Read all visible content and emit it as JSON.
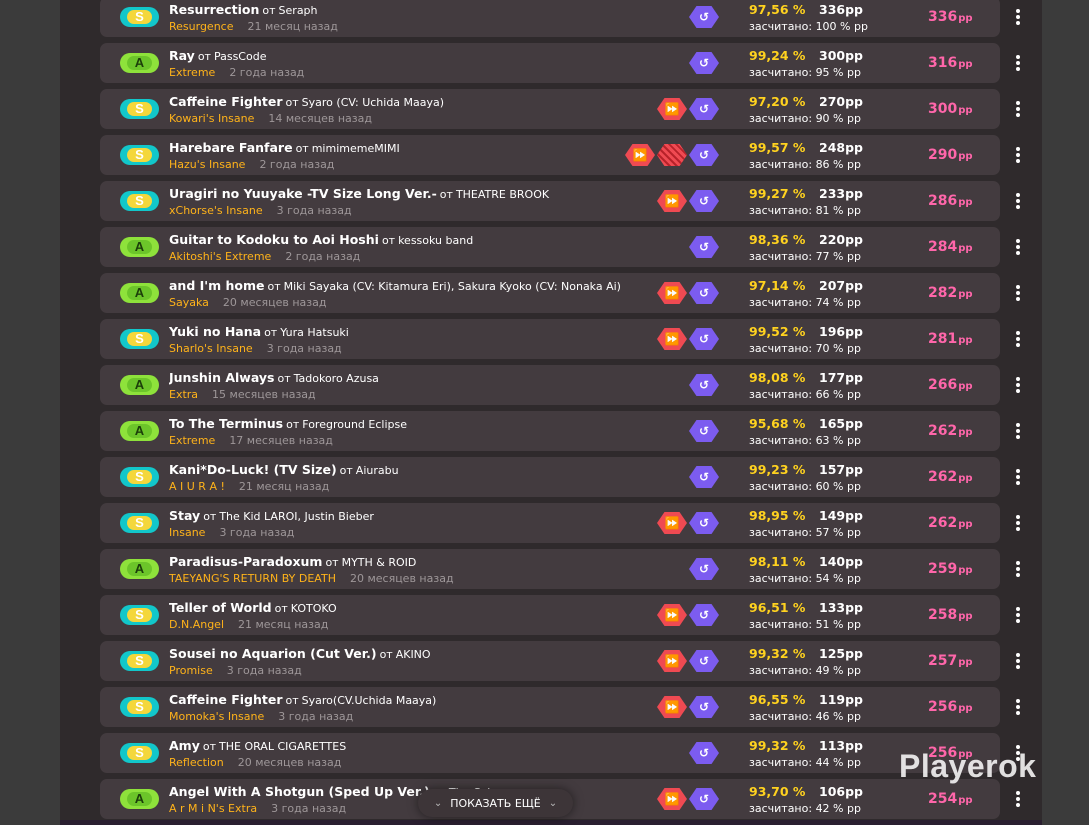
{
  "show_more": {
    "label": "ПОКАЗАТЬ ЕЩЁ"
  },
  "watermark": "Playerok",
  "by_word": "от",
  "counted_prefix": "засчитано:",
  "pp_unit": "pp",
  "colors": {
    "grade_S": "#12c7ca",
    "grade_A": "#8ee23b",
    "accuracy": "#ffd21f",
    "difficulty": "#ffb31a",
    "weighted_pp": "#ff66aa",
    "mod_purple": "#7c5cf0",
    "mod_red": "#ef4a52"
  },
  "scores": [
    {
      "grade": "S",
      "title": "Resurrection",
      "artist": "Seraph",
      "difficulty": "Resurgence",
      "ago": "21 месяц назад",
      "mods": [
        "pp"
      ],
      "accuracy": "97,56 %",
      "pp": "336pp",
      "weight": "100 % pp",
      "weighted": "336"
    },
    {
      "grade": "A",
      "title": "Ray",
      "artist": "PassCode",
      "difficulty": "Extreme",
      "ago": "2 года назад",
      "mods": [
        "pp"
      ],
      "accuracy": "99,24 %",
      "pp": "300pp",
      "weight": "95 % pp",
      "weighted": "316"
    },
    {
      "grade": "S",
      "title": "Caffeine Fighter",
      "artist": "Syaro (CV: Uchida Maaya)",
      "difficulty": "Kowari's Insane",
      "ago": "14 месяцев назад",
      "mods": [
        "ht",
        "pp"
      ],
      "accuracy": "97,20 %",
      "pp": "270pp",
      "weight": "90 % pp",
      "weighted": "300"
    },
    {
      "grade": "S",
      "title": "Harebare Fanfare",
      "artist": "mimimemeMIMI",
      "difficulty": "Hazu's Insane",
      "ago": "2 года назад",
      "mods": [
        "ht",
        "dt",
        "pp"
      ],
      "accuracy": "99,57 %",
      "pp": "248pp",
      "weight": "86 % pp",
      "weighted": "290"
    },
    {
      "grade": "S",
      "title": "Uragiri no Yuuyake -TV Size Long Ver.-",
      "artist": "THEATRE BROOK",
      "difficulty": "xChorse's Insane",
      "ago": "3 года назад",
      "mods": [
        "ht",
        "pp"
      ],
      "accuracy": "99,27 %",
      "pp": "233pp",
      "weight": "81 % pp",
      "weighted": "286"
    },
    {
      "grade": "A",
      "title": "Guitar to Kodoku to Aoi Hoshi",
      "artist": "kessoku band",
      "difficulty": "Akitoshi's Extreme",
      "ago": "2 года назад",
      "mods": [
        "pp"
      ],
      "accuracy": "98,36 %",
      "pp": "220pp",
      "weight": "77 % pp",
      "weighted": "284"
    },
    {
      "grade": "A",
      "title": "and I'm home",
      "artist": "Miki Sayaka (CV: Kitamura Eri), Sakura Kyoko (CV: Nonaka Ai)",
      "difficulty": "Sayaka",
      "ago": "20 месяцев назад",
      "mods": [
        "ht",
        "pp"
      ],
      "accuracy": "97,14 %",
      "pp": "207pp",
      "weight": "74 % pp",
      "weighted": "282"
    },
    {
      "grade": "S",
      "title": "Yuki no Hana",
      "artist": "Yura Hatsuki",
      "difficulty": "Sharlo's Insane",
      "ago": "3 года назад",
      "mods": [
        "ht",
        "pp"
      ],
      "accuracy": "99,52 %",
      "pp": "196pp",
      "weight": "70 % pp",
      "weighted": "281"
    },
    {
      "grade": "A",
      "title": "Junshin Always",
      "artist": "Tadokoro Azusa",
      "difficulty": "Extra",
      "ago": "15 месяцев назад",
      "mods": [
        "pp"
      ],
      "accuracy": "98,08 %",
      "pp": "177pp",
      "weight": "66 % pp",
      "weighted": "266"
    },
    {
      "grade": "A",
      "title": "To The Terminus",
      "artist": "Foreground Eclipse",
      "difficulty": "Extreme",
      "ago": "17 месяцев назад",
      "mods": [
        "pp"
      ],
      "accuracy": "95,68 %",
      "pp": "165pp",
      "weight": "63 % pp",
      "weighted": "262"
    },
    {
      "grade": "S",
      "title": "Kani*Do-Luck! (TV Size)",
      "artist": "Aiurabu",
      "difficulty": "A I U R A !",
      "ago": "21 месяц назад",
      "mods": [
        "pp"
      ],
      "accuracy": "99,23 %",
      "pp": "157pp",
      "weight": "60 % pp",
      "weighted": "262"
    },
    {
      "grade": "S",
      "title": "Stay",
      "artist": "The Kid LAROI, Justin Bieber",
      "difficulty": "Insane",
      "ago": "3 года назад",
      "mods": [
        "ht",
        "pp"
      ],
      "accuracy": "98,95 %",
      "pp": "149pp",
      "weight": "57 % pp",
      "weighted": "262"
    },
    {
      "grade": "A",
      "title": "Paradisus-Paradoxum",
      "artist": "MYTH & ROID",
      "difficulty": "TAEYANG'S RETURN BY DEATH",
      "ago": "20 месяцев назад",
      "mods": [
        "pp"
      ],
      "accuracy": "98,11 %",
      "pp": "140pp",
      "weight": "54 % pp",
      "weighted": "259"
    },
    {
      "grade": "S",
      "title": "Teller of World",
      "artist": "KOTOKO",
      "difficulty": "D.N.Angel",
      "ago": "21 месяц назад",
      "mods": [
        "ht",
        "pp"
      ],
      "accuracy": "96,51 %",
      "pp": "133pp",
      "weight": "51 % pp",
      "weighted": "258"
    },
    {
      "grade": "S",
      "title": "Sousei no Aquarion (Cut Ver.)",
      "artist": "AKINO",
      "difficulty": "Promise",
      "ago": "3 года назад",
      "mods": [
        "ht",
        "pp"
      ],
      "accuracy": "99,32 %",
      "pp": "125pp",
      "weight": "49 % pp",
      "weighted": "257"
    },
    {
      "grade": "S",
      "title": "Caffeine Fighter",
      "artist": "Syaro(CV.Uchida Maaya)",
      "difficulty": "Momoka's Insane",
      "ago": "3 года назад",
      "mods": [
        "ht",
        "pp"
      ],
      "accuracy": "96,55 %",
      "pp": "119pp",
      "weight": "46 % pp",
      "weighted": "256"
    },
    {
      "grade": "S",
      "title": "Amy",
      "artist": "THE ORAL CIGARETTES",
      "difficulty": "Reflection",
      "ago": "20 месяцев назад",
      "mods": [
        "pp"
      ],
      "accuracy": "99,32 %",
      "pp": "113pp",
      "weight": "44 % pp",
      "weighted": "256"
    },
    {
      "grade": "A",
      "title": "Angel With A Shotgun (Sped Up Ver.)",
      "artist": "The Cab",
      "difficulty": "A r M i N's Extra",
      "ago": "3 года назад",
      "mods": [
        "ht",
        "pp"
      ],
      "accuracy": "93,70 %",
      "pp": "106pp",
      "weight": "42 % pp",
      "weighted": "254"
    }
  ]
}
